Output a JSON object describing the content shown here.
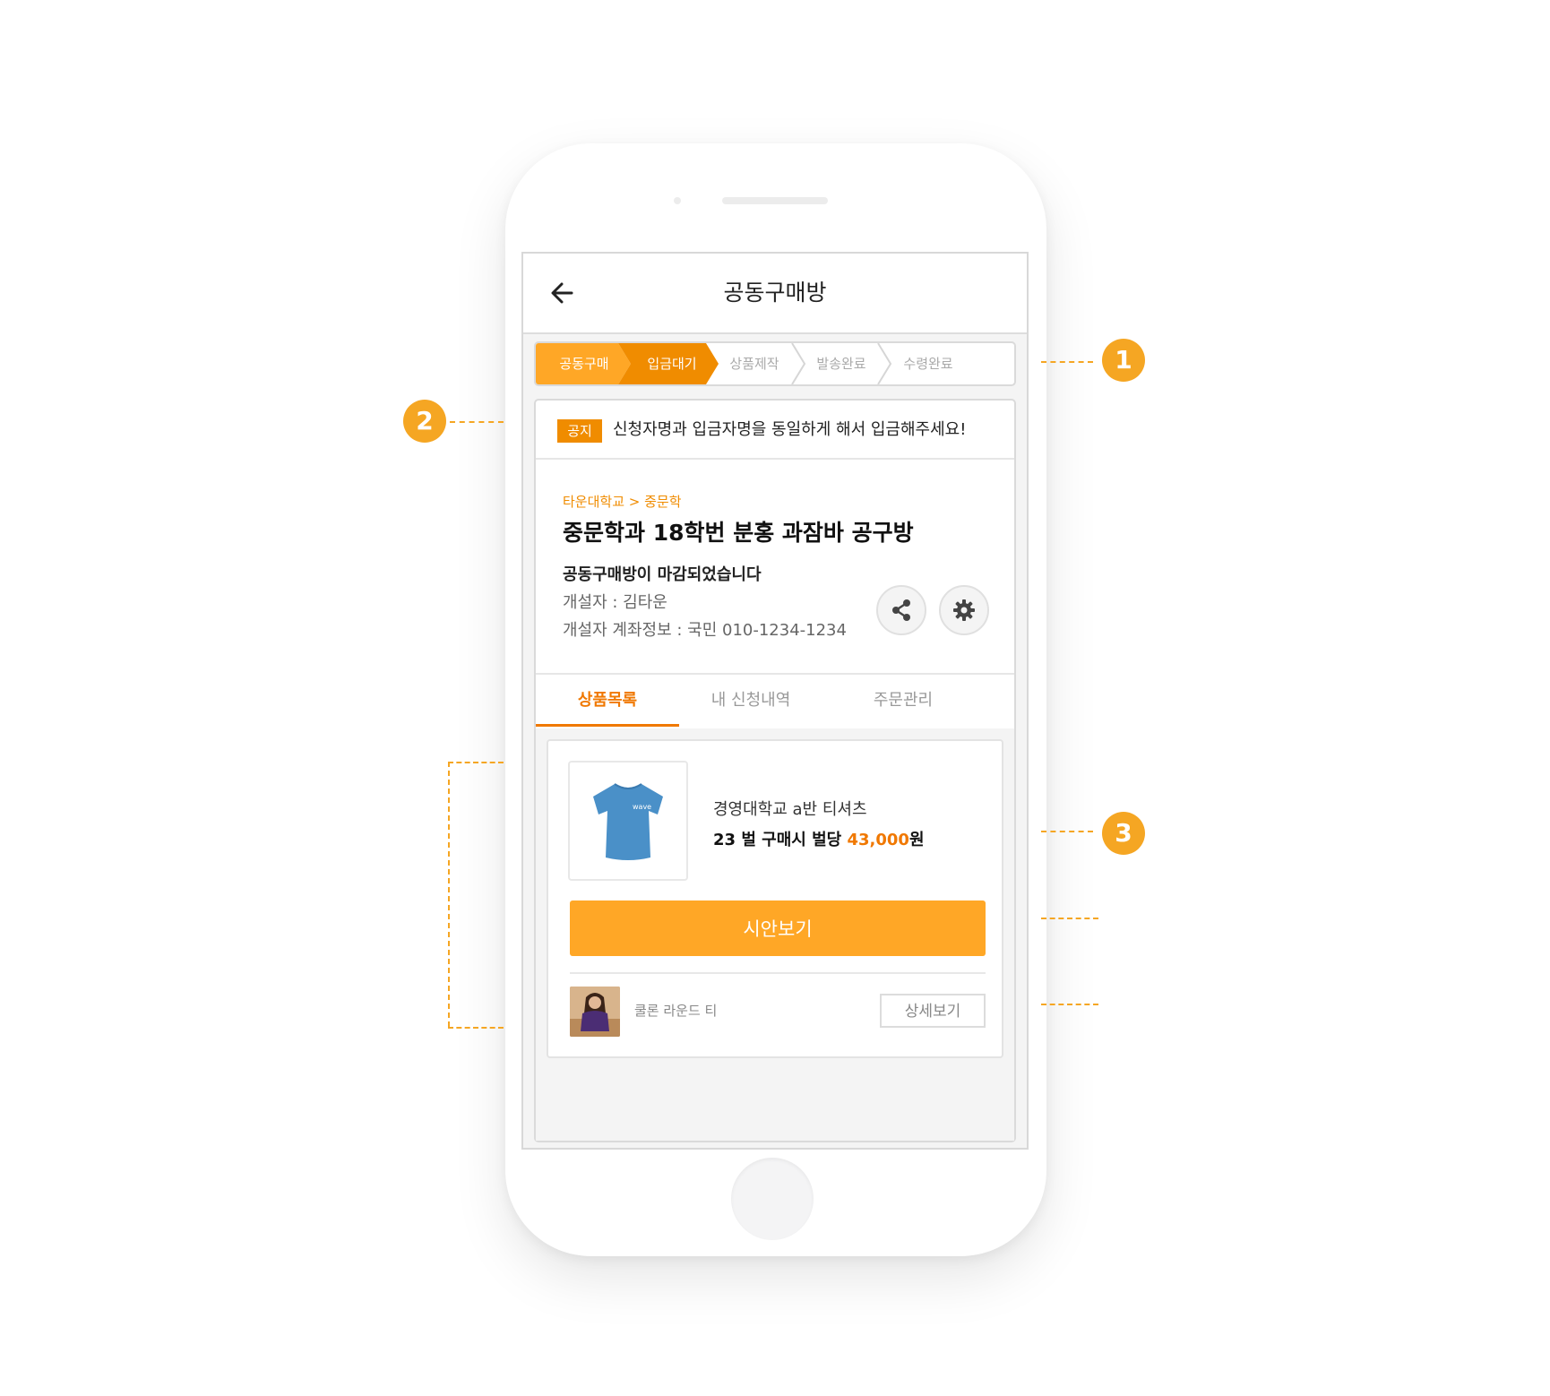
{
  "header": {
    "title": "공동구매방"
  },
  "steps": [
    {
      "label": "공동구매",
      "active": true
    },
    {
      "label": "입금대기",
      "active": true
    },
    {
      "label": "상품제작",
      "active": false
    },
    {
      "label": "발송완료",
      "active": false
    },
    {
      "label": "수령완료",
      "active": false
    }
  ],
  "notice": {
    "badge": "공지",
    "text": "신청자명과 입금자명을 동일하게 해서 입금해주세요!"
  },
  "room": {
    "breadcrumb": "타운대학교 > 중문학",
    "title": "중문학과 18학번 분홍 과잠바 공구방",
    "status": "공동구매방이 마감되었습니다",
    "creator": "개설자 : 김타운",
    "account": "개설자 계좌정보 : 국민 010-1234-1234"
  },
  "tabs": [
    {
      "label": "상품목록",
      "active": true
    },
    {
      "label": "내 신청내역",
      "active": false
    },
    {
      "label": "주문관리",
      "active": false
    }
  ],
  "product": {
    "name": "경영대학교 a반 티셔츠",
    "price_prefix": "23 벌 구매시 벌당",
    "price": "43,000",
    "price_suffix": "원",
    "shirt_text": "wave",
    "cta_label": "시안보기",
    "sub_item_name": "쿨론 라운드 티",
    "detail_label": "상세보기"
  },
  "annotations": {
    "marker_1": "1",
    "marker_2": "2",
    "marker_3": "3"
  },
  "colors": {
    "accent": "#f5a623",
    "step_active": "#ffa726",
    "step_current": "#f08c00",
    "tab_active": "#f07800"
  },
  "icons": [
    "back-arrow-icon",
    "share-icon",
    "gear-icon"
  ]
}
